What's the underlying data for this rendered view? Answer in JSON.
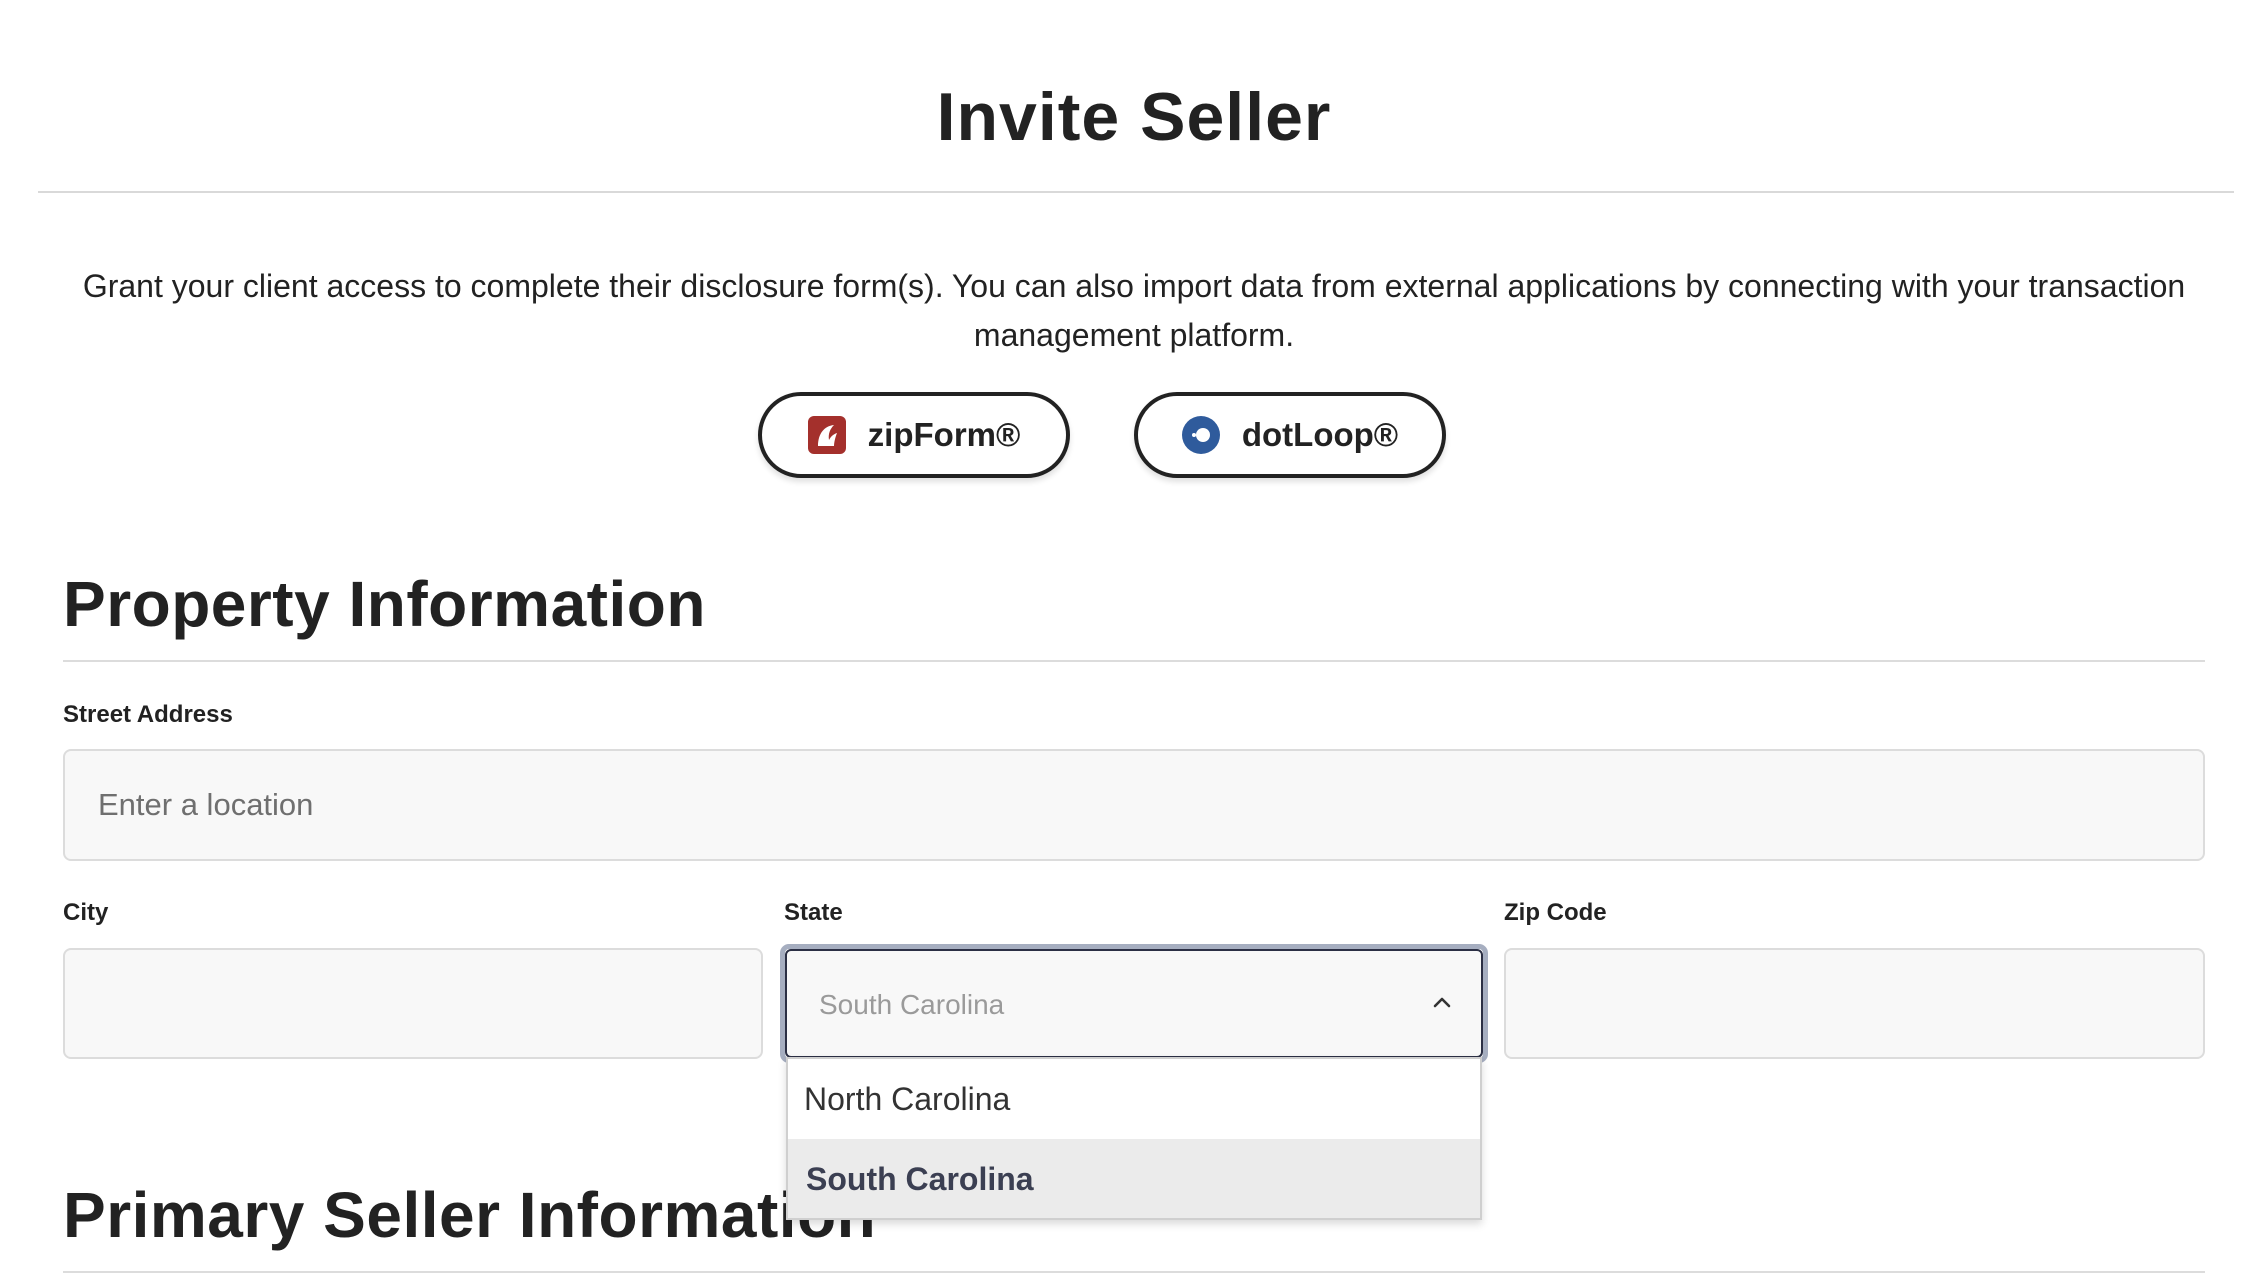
{
  "page": {
    "title": "Invite Seller",
    "intro": "Grant your client access to complete their disclosure form(s). You can also import data from external applications by connecting with your transaction management platform."
  },
  "integrations": [
    {
      "label": "zipForm®",
      "icon": "zipform-logo-icon",
      "color": "#a4302c"
    },
    {
      "label": "dotLoop®",
      "icon": "dotloop-logo-icon",
      "color": "#2f5b9c"
    }
  ],
  "property_section": {
    "title": "Property Information",
    "street": {
      "label": "Street Address",
      "placeholder": "Enter a location",
      "value": ""
    },
    "city": {
      "label": "City",
      "value": ""
    },
    "state": {
      "label": "State",
      "value": "South Carolina",
      "options": [
        "North Carolina",
        "South Carolina"
      ],
      "selected": "South Carolina",
      "icon": "chevron-up-icon"
    },
    "zip": {
      "label": "Zip Code",
      "value": ""
    }
  },
  "seller_section": {
    "title": "Primary Seller Information"
  }
}
